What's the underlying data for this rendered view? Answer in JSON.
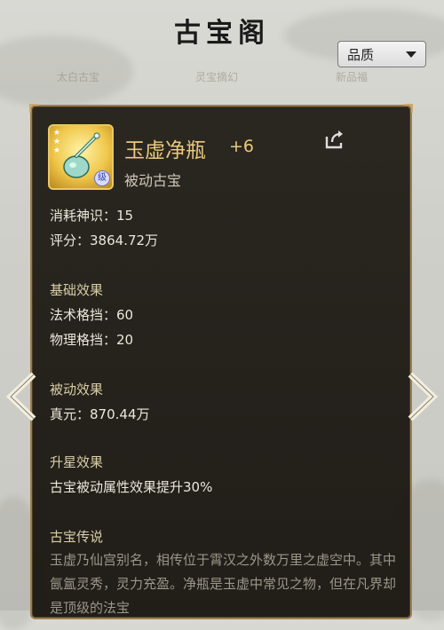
{
  "header": {
    "title": "古宝阁"
  },
  "background_tabs": [
    "太白古宝",
    "灵宝摘幻",
    "新品福"
  ],
  "quality_dropdown": {
    "label": "品质"
  },
  "item": {
    "name": "玉虚净瓶",
    "upgrade": "+6",
    "type": "被动古宝",
    "rank_badge": "级",
    "stars": 3,
    "divine_sense": "消耗神识：15",
    "score": "评分：3864.72万"
  },
  "sections": {
    "basic": {
      "title": "基础效果",
      "lines": [
        "法术格挡：60",
        "物理格挡：20"
      ]
    },
    "passive": {
      "title": "被动效果",
      "lines": [
        "真元：870.44万"
      ]
    },
    "star": {
      "title": "升星效果",
      "lines": [
        "古宝被动属性效果提升30%"
      ]
    },
    "lore": {
      "title": "古宝传说",
      "text": "玉虚乃仙宫别名，相传位于霄汉之外数万里之虚空中。其中氤氲灵秀，灵力充盈。净瓶是玉虚中常见之物，但在凡界却是顶级的法宝"
    }
  },
  "icons": {
    "share": "share-icon",
    "left": "chevron-left-icon",
    "right": "chevron-right-icon",
    "dropdown": "triangle-down-icon"
  },
  "colors": {
    "gold_text": "#e9c97c",
    "section_title": "#d8cfa6",
    "panel_border": "#9b7f52"
  }
}
